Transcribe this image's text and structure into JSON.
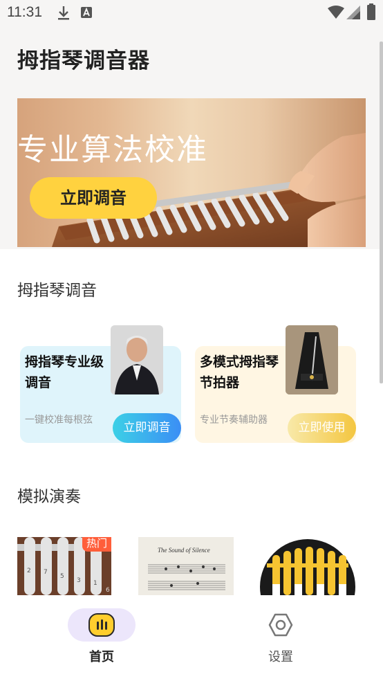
{
  "status_bar": {
    "time": "11:31"
  },
  "app": {
    "title": "拇指琴调音器"
  },
  "banner": {
    "headline": "专业算法校准",
    "button_label": "立即调音"
  },
  "tuning_section": {
    "title": "拇指琴调音",
    "cards": [
      {
        "title": "拇指琴专业级调音",
        "subtitle": "一键校准每根弦",
        "button_label": "立即调音"
      },
      {
        "title": "多模式拇指琴节拍器",
        "subtitle": "专业节奏辅助器",
        "button_label": "立即使用"
      }
    ]
  },
  "simulate_section": {
    "title": "模拟演奏",
    "items": [
      {
        "badge": "热门",
        "key_numbers": [
          "2",
          "7",
          "5",
          "3",
          "1",
          "6"
        ]
      },
      {
        "sheet_title": "The Sound of Silence"
      },
      {}
    ]
  },
  "bottom_nav": {
    "items": [
      {
        "label": "首页",
        "active": true
      },
      {
        "label": "设置",
        "active": false
      }
    ]
  },
  "colors": {
    "accent_yellow": "#ffd23f",
    "tune_btn_blue": "#3aa0f5",
    "use_btn_yellow": "#f5c84a",
    "nav_active_bg": "#ece6fb"
  }
}
